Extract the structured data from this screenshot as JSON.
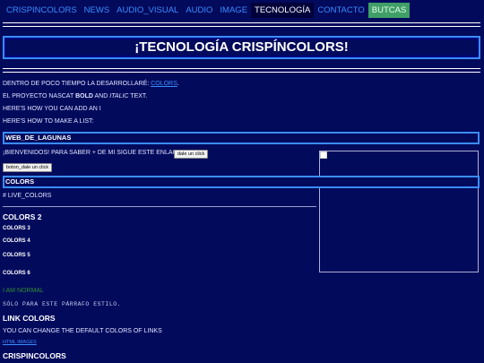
{
  "nav": {
    "items": [
      "CRISPINCOLORS",
      "NEWS",
      "AUDIO_VISUAL",
      "AUDIO",
      "IMAGE",
      "TECNOLOGÍA",
      "CONTACTO"
    ],
    "active_index": 5,
    "buy_label": "BUTCAS"
  },
  "banner": {
    "title": "¡TECNOLOGÍA CRISPÍNCOLORS!"
  },
  "intro": {
    "line1_prefix": "DENTRO DE POCO TIEMPO LA DESARROLLARÉ:",
    "line1_link": "COLORS",
    "line1_suffix": ".",
    "line2_prefix": "EL PROYECTO NASCAT",
    "line2_bold": "BOLD",
    "line2_and": "AND",
    "line2_italic": "ITALIC",
    "line2_suffix": "TEXT.",
    "line3": "HERE'S HOW YOU CAN ADD AN I",
    "line4": "HERE'S HOW TO MAKE A LIST:"
  },
  "section_web": "WEB_DE_LAGUNAS",
  "welcome": {
    "text": "¡BIENVENIDOS! PARA SABER + DE MI SIGUE ESTE ENLACE:",
    "button": "dale un click",
    "button2": "boton_dale un click"
  },
  "section_colors": "COLORS",
  "live_colors": "# LIVE_COLORS",
  "headings": [
    "COLORS 2",
    "COLORS 3",
    "COLORS 4",
    "COLORS 5",
    "COLORS 6"
  ],
  "normal_text": "I AM NORMAL",
  "mono_text": "SÓLO PARA ESTE PÁRRAFO ESTILO.",
  "link_colors_heading": "LINK COLORS",
  "link_colors_text": "YOU CAN CHANGE THE DEFAULT COLORS OF LINKS",
  "html_images_link": "HTML IMAGES",
  "footer_heading": "CRISPINCOLORS",
  "colors": {
    "background": "#020a5c",
    "accent": "#3a8dff",
    "active_tab": "#00003a",
    "buy": "#3f9f67",
    "green_text": "#2f8f2f"
  }
}
